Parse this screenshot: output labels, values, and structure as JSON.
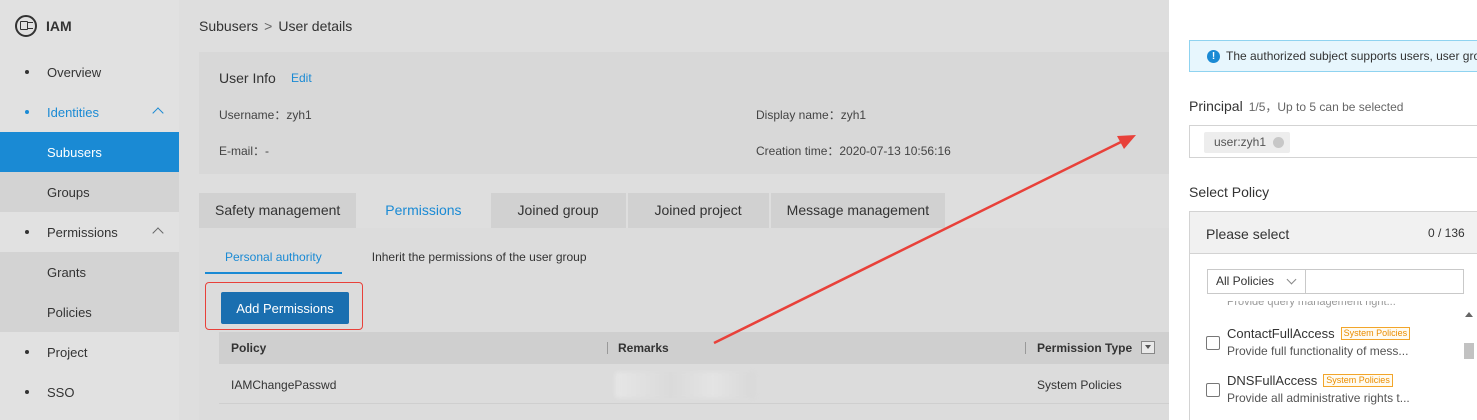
{
  "brand": {
    "title": "IAM",
    "icon": "iam-card-icon"
  },
  "sidebar": {
    "items": [
      {
        "label": "Overview",
        "type": "item"
      },
      {
        "label": "Identities",
        "type": "group",
        "open": true
      },
      {
        "label": "Subusers",
        "type": "sub",
        "active": true
      },
      {
        "label": "Groups",
        "type": "sub"
      },
      {
        "label": "Permissions",
        "type": "group",
        "open": true
      },
      {
        "label": "Grants",
        "type": "sub"
      },
      {
        "label": "Policies",
        "type": "sub"
      },
      {
        "label": "Project",
        "type": "item"
      },
      {
        "label": "SSO",
        "type": "item"
      }
    ]
  },
  "breadcrumb": {
    "parent": "Subusers",
    "separator": ">",
    "current": "User details"
  },
  "user_info": {
    "title": "User Info",
    "edit_label": "Edit",
    "username": "Username：zyh1",
    "display_name": "Display name：zyh1",
    "email": "E-mail：-",
    "creation_time": "Creation time：2020-07-13 10:56:16"
  },
  "tabs": [
    "Safety management",
    "Permissions",
    "Joined group",
    "Joined project",
    "Message management"
  ],
  "active_tab": "Permissions",
  "subtabs": [
    "Personal authority",
    "Inherit the permissions of the user group"
  ],
  "add_button_label": "Add Permissions",
  "table": {
    "headers": [
      "Policy",
      "Remarks",
      "Permission Type"
    ],
    "rows": [
      {
        "policy": "IAMChangePasswd",
        "remarks": "",
        "type": "System Policies"
      }
    ]
  },
  "drawer": {
    "alert_text": "The authorized subject supports users, user gro",
    "principal_label": "Principal",
    "principal_hint": "1/5，Up to 5 can be selected",
    "principal_chip": "user:zyh1",
    "policy_label": "Select Policy",
    "panel_title": "Please select",
    "panel_count": "0 / 136",
    "filter_value": "All Policies",
    "clipped_text": "Provide query management right...",
    "policies": [
      {
        "name": "ContactFullAccess",
        "tag": "System Policies",
        "desc": "Provide full functionality of mess..."
      },
      {
        "name": "DNSFullAccess",
        "tag": "System Policies",
        "desc": "Provide all administrative rights t..."
      }
    ]
  },
  "colors": {
    "accent": "#1a8ad4",
    "button": "#1a6fb0",
    "highlight": "#e8413a",
    "tag": "#ea8d00"
  }
}
